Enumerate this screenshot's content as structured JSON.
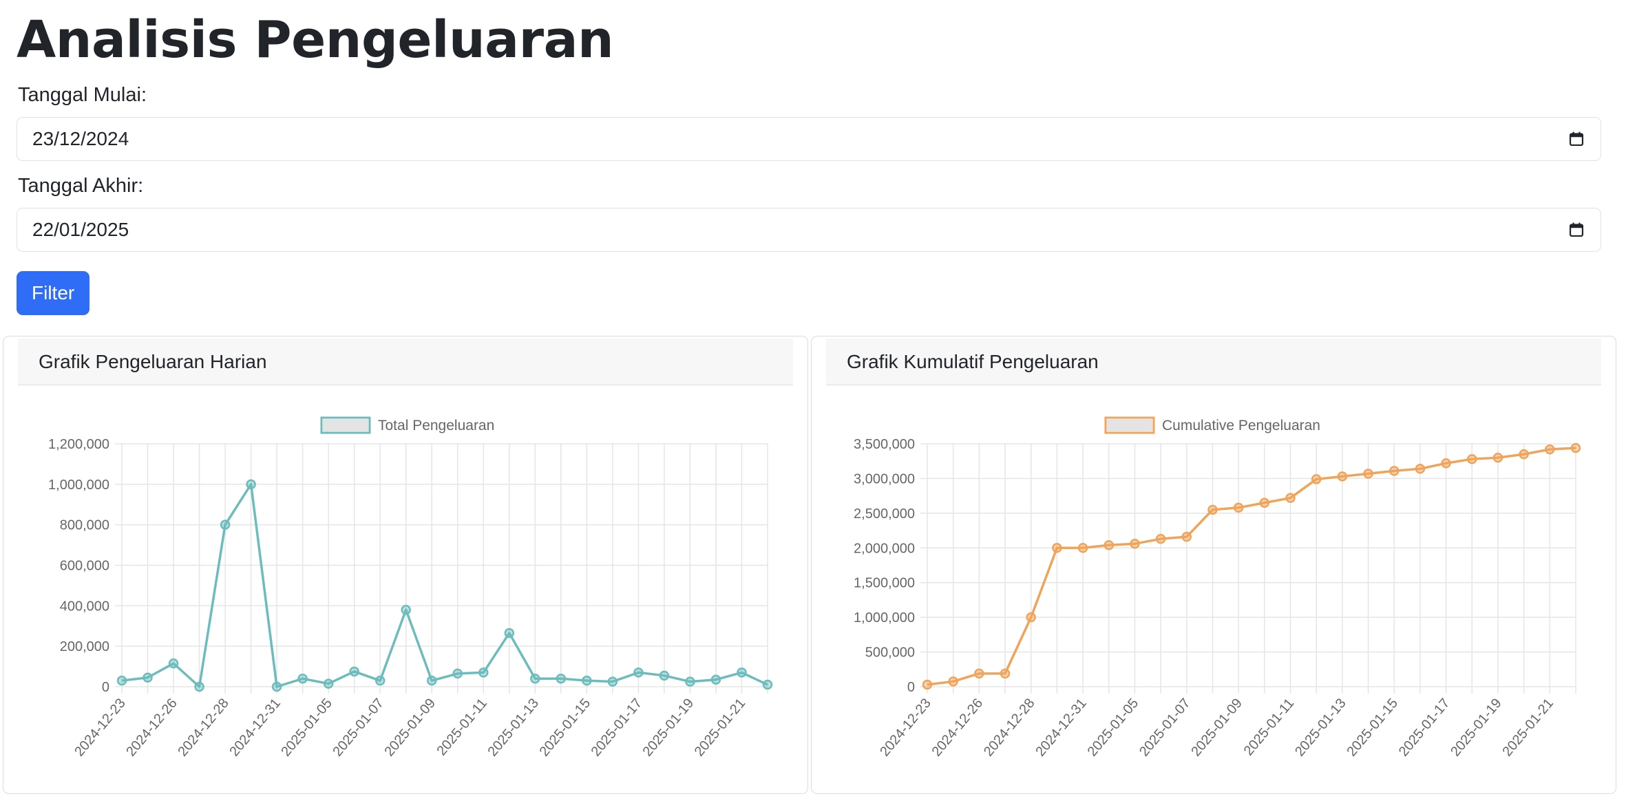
{
  "page": {
    "title": "Analisis Pengeluaran",
    "start_label": "Tanggal Mulai:",
    "start_value": "23/12/2024",
    "end_label": "Tanggal Akhir:",
    "end_value": "22/01/2025",
    "filter_label": "Filter"
  },
  "cards": {
    "daily_title": "Grafik Pengeluaran Harian",
    "cumulative_title": "Grafik Kumulatif Pengeluaran"
  },
  "chart_data": [
    {
      "type": "line",
      "title": "",
      "xlabel": "",
      "ylabel": "",
      "legend": "top",
      "grid": true,
      "ylim": [
        0,
        1200000
      ],
      "yticks": [
        "1,200,000",
        "1,000,000",
        "800,000",
        "600,000",
        "400,000",
        "200,000",
        "0"
      ],
      "xticks": [
        "2024-12-23",
        "2024-12-26",
        "2024-12-28",
        "2024-12-31",
        "2025-01-05",
        "2025-01-07",
        "2025-01-09",
        "2025-01-11",
        "2025-01-13",
        "2025-01-15",
        "2025-01-17",
        "2025-01-19",
        "2025-01-21"
      ],
      "color": "#6dbcbd",
      "series": [
        {
          "name": "Total Pengeluaran",
          "values": [
            30000,
            45000,
            115000,
            0,
            800000,
            1000000,
            0,
            40000,
            15000,
            75000,
            30000,
            380000,
            30000,
            65000,
            70000,
            265000,
            40000,
            40000,
            30000,
            25000,
            70000,
            55000,
            25000,
            35000,
            70000,
            10000
          ]
        }
      ]
    },
    {
      "type": "line",
      "title": "",
      "xlabel": "",
      "ylabel": "",
      "legend": "top",
      "grid": true,
      "ylim": [
        0,
        3500000
      ],
      "yticks": [
        "3,500,000",
        "3,000,000",
        "2,500,000",
        "2,000,000",
        "1,500,000",
        "1,000,000",
        "500,000",
        "0"
      ],
      "xticks": [
        "2024-12-23",
        "2024-12-26",
        "2024-12-28",
        "2024-12-31",
        "2025-01-05",
        "2025-01-07",
        "2025-01-09",
        "2025-01-11",
        "2025-01-13",
        "2025-01-15",
        "2025-01-17",
        "2025-01-19",
        "2025-01-21"
      ],
      "color": "#f0a45a",
      "series": [
        {
          "name": "Cumulative Pengeluaran",
          "values": [
            30000,
            75000,
            190000,
            190000,
            1000000,
            2000000,
            2000000,
            2040000,
            2060000,
            2130000,
            2160000,
            2550000,
            2580000,
            2650000,
            2720000,
            2990000,
            3030000,
            3070000,
            3110000,
            3140000,
            3220000,
            3280000,
            3300000,
            3350000,
            3420000,
            3440000
          ]
        }
      ]
    }
  ]
}
